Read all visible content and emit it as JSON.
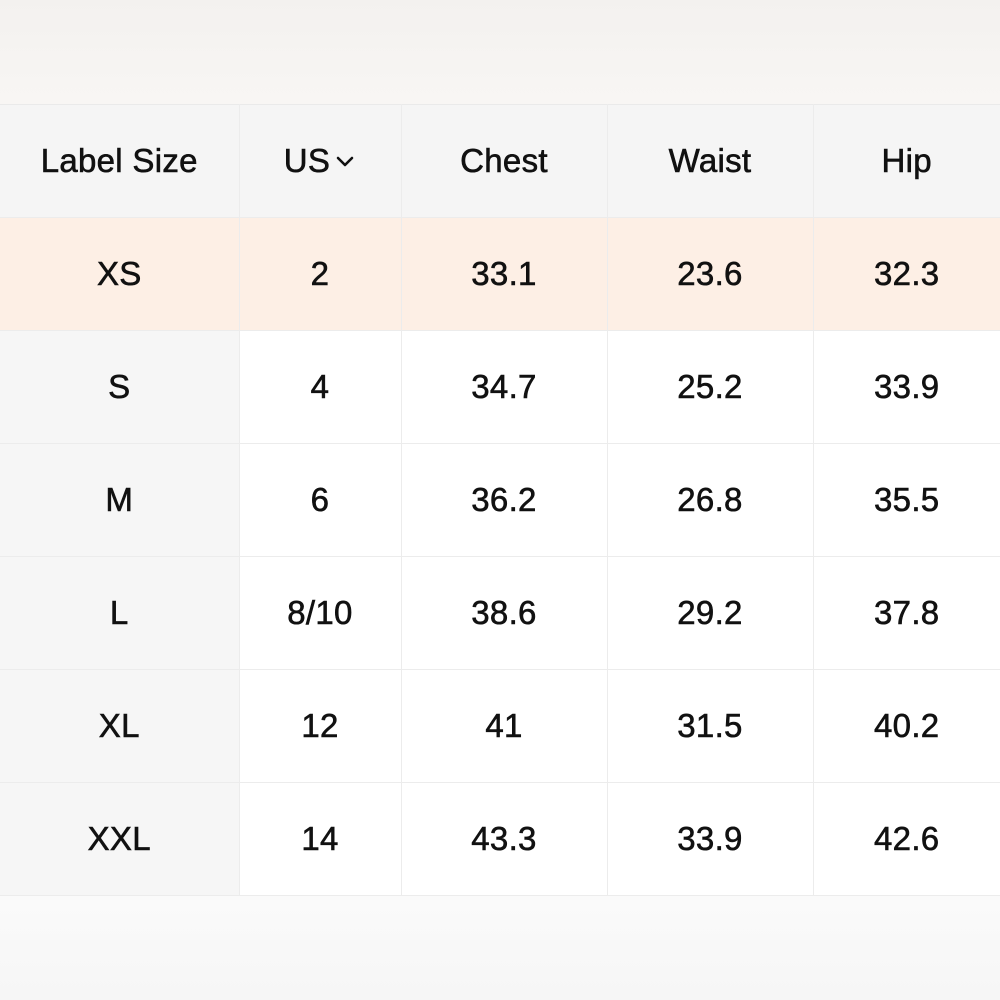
{
  "table": {
    "headers": {
      "label_size": "Label Size",
      "us": "US",
      "chest": "Chest",
      "waist": "Waist",
      "hip": "Hip"
    },
    "us_dropdown_icon": "chevron-down-icon",
    "highlight_color": "#fdefe5",
    "rows": [
      {
        "label": "XS",
        "us": "2",
        "chest": "33.1",
        "waist": "23.6",
        "hip": "32.3",
        "highlighted": true
      },
      {
        "label": "S",
        "us": "4",
        "chest": "34.7",
        "waist": "25.2",
        "hip": "33.9",
        "highlighted": false
      },
      {
        "label": "M",
        "us": "6",
        "chest": "36.2",
        "waist": "26.8",
        "hip": "35.5",
        "highlighted": false
      },
      {
        "label": "L",
        "us": "8/10",
        "chest": "38.6",
        "waist": "29.2",
        "hip": "37.8",
        "highlighted": false
      },
      {
        "label": "XL",
        "us": "12",
        "chest": "41",
        "waist": "31.5",
        "hip": "40.2",
        "highlighted": false
      },
      {
        "label": "XXL",
        "us": "14",
        "chest": "43.3",
        "waist": "33.9",
        "hip": "42.6",
        "highlighted": false
      }
    ]
  }
}
